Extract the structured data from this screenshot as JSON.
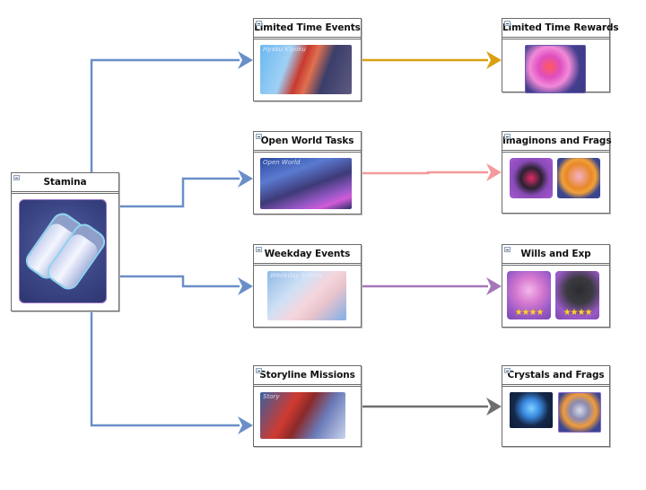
{
  "diagram": {
    "type": "flow",
    "root": {
      "id": "stamina",
      "title": "Stamina",
      "icon": "stamina-canisters-icon"
    },
    "activities": [
      {
        "id": "limited-time-events",
        "title": "Limited Time Events",
        "image": "limited-time-events-banner",
        "banner_text": "Hyaku Kiyoku"
      },
      {
        "id": "open-world-tasks",
        "title": "Open World Tasks",
        "image": "open-world-banner",
        "banner_text": "Open World"
      },
      {
        "id": "weekday-events",
        "title": "Weekday Events",
        "image": "weekday-events-banner",
        "banner_text": "Weekday Events"
      },
      {
        "id": "storyline-missions",
        "title": "Storyline Missions",
        "image": "storyline-banner",
        "banner_text": "Story"
      }
    ],
    "rewards": [
      {
        "id": "limited-time-rewards",
        "title": "Limited Time Rewards",
        "items": [
          {
            "icon": "event-reward-icon"
          }
        ]
      },
      {
        "id": "imaginons-and-frags",
        "title": "Imaginons and Frags",
        "items": [
          {
            "icon": "imaginon-icon"
          },
          {
            "icon": "character-fragment-icon"
          }
        ]
      },
      {
        "id": "wills-and-exp",
        "title": "Wills and Exp",
        "items": [
          {
            "icon": "will-material-icon",
            "stars": "★★★★"
          },
          {
            "icon": "exp-material-icon",
            "stars": "★★★★"
          }
        ]
      },
      {
        "id": "crystals-and-frags",
        "title": "Crystals and Frags",
        "items": [
          {
            "icon": "crystal-icon"
          },
          {
            "icon": "character-fragment-icon"
          }
        ]
      }
    ],
    "edges": [
      {
        "from": "stamina",
        "to": "limited-time-events",
        "color": "#6a8fc8"
      },
      {
        "from": "stamina",
        "to": "open-world-tasks",
        "color": "#6a8fc8"
      },
      {
        "from": "stamina",
        "to": "weekday-events",
        "color": "#6a8fc8"
      },
      {
        "from": "stamina",
        "to": "storyline-missions",
        "color": "#6a8fc8"
      },
      {
        "from": "limited-time-events",
        "to": "limited-time-rewards",
        "color": "#d9a011"
      },
      {
        "from": "open-world-tasks",
        "to": "imaginons-and-frags",
        "color": "#f59a9a"
      },
      {
        "from": "weekday-events",
        "to": "wills-and-exp",
        "color": "#a677b8"
      },
      {
        "from": "storyline-missions",
        "to": "crystals-and-frags",
        "color": "#6e6e6e"
      }
    ]
  }
}
